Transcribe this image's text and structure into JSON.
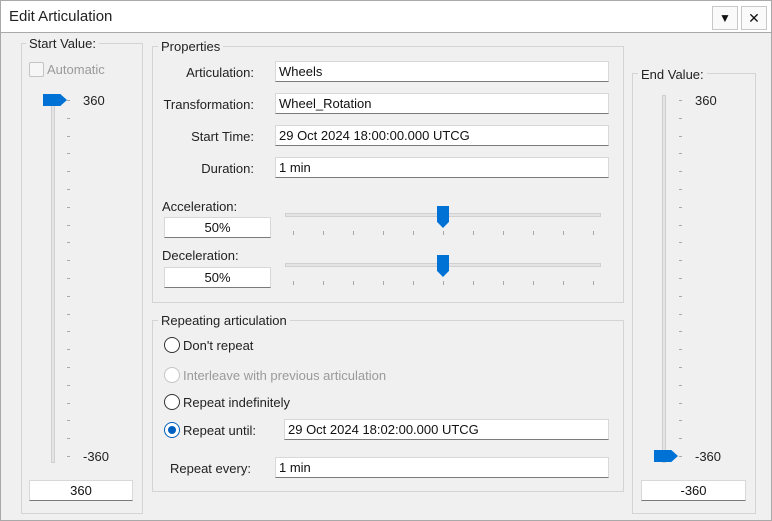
{
  "window": {
    "title": "Edit Articulation",
    "dropdown_glyph": "▼",
    "close_glyph": "✕"
  },
  "start_value": {
    "label": "Start Value:",
    "automatic_label": "Automatic",
    "max_label": "360",
    "min_label": "-360",
    "value": "360",
    "slider_level": 1.0
  },
  "end_value": {
    "label": "End Value:",
    "max_label": "360",
    "min_label": "-360",
    "value": "-360",
    "slider_level": 0.0
  },
  "properties": {
    "label": "Properties",
    "articulation_label": "Articulation:",
    "articulation_value": "Wheels",
    "transformation_label": "Transformation:",
    "transformation_value": "Wheel_Rotation",
    "start_time_label": "Start Time:",
    "start_time_value": "29 Oct 2024 18:00:00.000 UTCG",
    "duration_label": "Duration:",
    "duration_value": "1 min",
    "acceleration_label": "Acceleration:",
    "acceleration_value": "50%",
    "acceleration_level": 0.5,
    "deceleration_label": "Deceleration:",
    "deceleration_value": "50%",
    "deceleration_level": 0.5
  },
  "repeating": {
    "label": "Repeating articulation",
    "dont_repeat_label": "Don't repeat",
    "interleave_label": "Interleave with previous articulation",
    "repeat_indefinitely_label": "Repeat indefinitely",
    "repeat_until_label": "Repeat until:",
    "repeat_until_value": "29 Oct 2024 18:02:00.000 UTCG",
    "repeat_every_label": "Repeat every:",
    "repeat_every_value": "1 min",
    "selected": "repeat_until"
  },
  "colors": {
    "accent": "#0072d6",
    "background": "#f0f0f0"
  },
  "icons": {
    "dropdown": "chevron-down-icon",
    "close": "close-icon"
  }
}
